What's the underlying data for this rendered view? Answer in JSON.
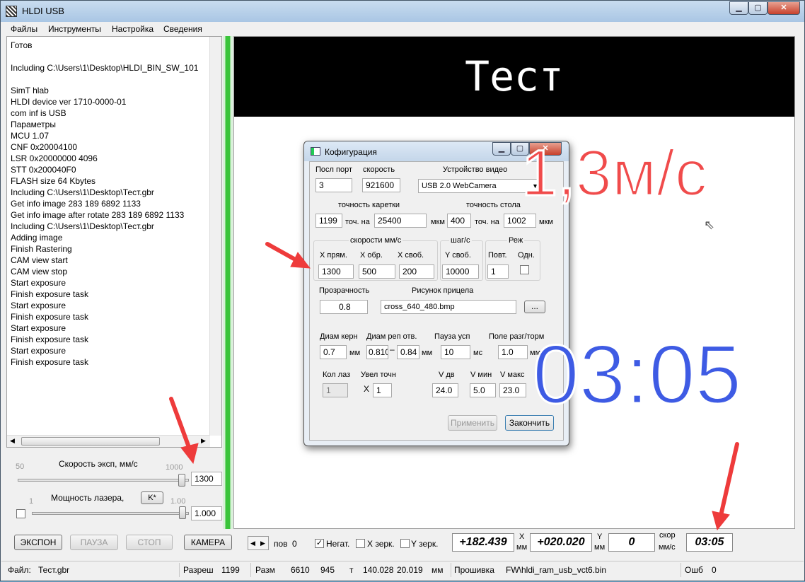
{
  "window": {
    "title": "HLDI USB"
  },
  "menu": [
    "Файлы",
    "Инструменты",
    "Настройка",
    "Сведения"
  ],
  "log_lines": [
    "Готов",
    "",
    "Including C:\\Users\\1\\Desktop\\HLDI_BIN_SW_101",
    "",
    "SimT hlab",
    "HLDI device ver 1710-0000-01",
    "com inf is USB",
    "Параметры",
    "MCU 1.07",
    "CNF 0x20004100",
    "LSR 0x20000000 4096",
    "STT 0x200040F0",
    "FLASH size 64 Kbytes",
    "Including C:\\Users\\1\\Desktop\\Тест.gbr",
    "Get info image 283 189 6892 1133",
    "Get info image after rotate 283 189 6892 1133",
    "Including C:\\Users\\1\\Desktop\\Тест.gbr",
    "Adding image",
    "Finish Rastering",
    "CAM view start",
    "CAM view stop",
    "Start exposure",
    "Finish exposure task",
    "Start exposure",
    "Finish exposure task",
    "Start exposure",
    "Finish exposure task",
    "Start exposure",
    "Finish exposure task"
  ],
  "speed": {
    "label": "Скорость эксп, мм/с",
    "min": "50",
    "max": "1000",
    "value": "1300",
    "level": 0.98
  },
  "laser": {
    "label": "Мощность лазера,",
    "k_button": "K*",
    "min": "1",
    "max": "1.00",
    "value": "1.000",
    "level": 0.98
  },
  "buttons": {
    "expose": "ЭКСПОН",
    "pause": "ПАУЗА",
    "stop": "СТОП",
    "camera": "КАМЕРА"
  },
  "display": {
    "banner_text": "Тест"
  },
  "overlays": {
    "speed_text": "1,3м/с",
    "timer_text": "03:05"
  },
  "bottom": {
    "pov_label": "пов",
    "pov_value": "0",
    "negat_label": "Негат.",
    "negat_checked": true,
    "x_mirror_label": "X зерк.",
    "y_mirror_label": "Y зерк.",
    "x_value": "+182.439",
    "x_unit_top": "X",
    "x_unit_bottom": "мм",
    "y_value": "+020.020",
    "y_unit_top": "Y",
    "y_unit_bottom": "мм",
    "speed_value": "0",
    "speed_unit_top": "скор",
    "speed_unit_bottom": "мм/с",
    "time_value": "03:05"
  },
  "status": {
    "file_label": "Файл:",
    "file_value": "Тест.gbr",
    "res_label": "Разреш",
    "res_value": "1199",
    "size_label": "Разм",
    "size_w": "6610",
    "size_h": "945",
    "t_label": "т",
    "dim_w": "140.028",
    "dim_h": "20.019",
    "dim_unit": "мм",
    "fw_label": "Прошивка",
    "fw_value": "FW\\hldi_ram_usb_vct6.bin",
    "err_label": "Ошб",
    "err_value": "0"
  },
  "dialog": {
    "title": "Кофигурация",
    "port_label": "Посл порт",
    "port_value": "3",
    "speed_label": "скорость",
    "speed_value": "921600",
    "video_label": "Устройство видео",
    "video_value": "USB 2.0 WebCamera",
    "carriage_label": "точность каретки",
    "carriage_points": "1199",
    "carriage_mid": "точ. на",
    "carriage_um": "25400",
    "carriage_unit": "мкм",
    "table_label": "точность стола",
    "table_points": "400",
    "table_mid": "точ. на",
    "table_um": "1002",
    "table_unit": "мкм",
    "speeds_group": "скорости мм/с",
    "x_work_label": "X прям.",
    "x_work_value": "1300",
    "x_back_label": "X обр.",
    "x_back_value": "500",
    "x_free_label": "X своб.",
    "x_free_value": "200",
    "step_group": "шаг/с",
    "y_free_label": "Y своб.",
    "y_free_value": "10000",
    "mode_group": "Реж",
    "repeat_label": "Повт.",
    "repeat_value": "1",
    "single_label": "Одн.",
    "transparency_label": "Прозрачность",
    "transparency_value": "0.8",
    "crosshair_label": "Рисунок прицела",
    "crosshair_value": "cross_640_480.bmp",
    "browse_label": "...",
    "core_label": "Диам керн",
    "core_value": "0.7",
    "core_unit": "мм",
    "rep_label": "Диам реп отв.",
    "rep_from": "0.810",
    "rep_dash": "–",
    "rep_to": "0.84",
    "rep_unit": "мм",
    "pause_label": "Пауза усп",
    "pause_value": "10",
    "pause_unit": "мс",
    "field_label": "Поле разг/торм",
    "field_value": "1.0",
    "field_unit": "мм",
    "lasers_label": "Кол лаз",
    "lasers_value": "1",
    "enlarge_label": "Увел точн",
    "enlarge_x": "X",
    "enlarge_value": "1",
    "vdv_label": "V дв",
    "vdv_value": "24.0",
    "vmin_label": "V мин",
    "vmin_value": "5.0",
    "vmax_label": "V макс",
    "vmax_value": "23.0",
    "apply_label": "Применить",
    "finish_label": "Закончить"
  },
  "colors": {
    "overlay_red": "#f04b4b",
    "overlay_blue": "#3e5be4",
    "arrow": "#ee3b3b",
    "progress_green": "#3ac43a"
  }
}
